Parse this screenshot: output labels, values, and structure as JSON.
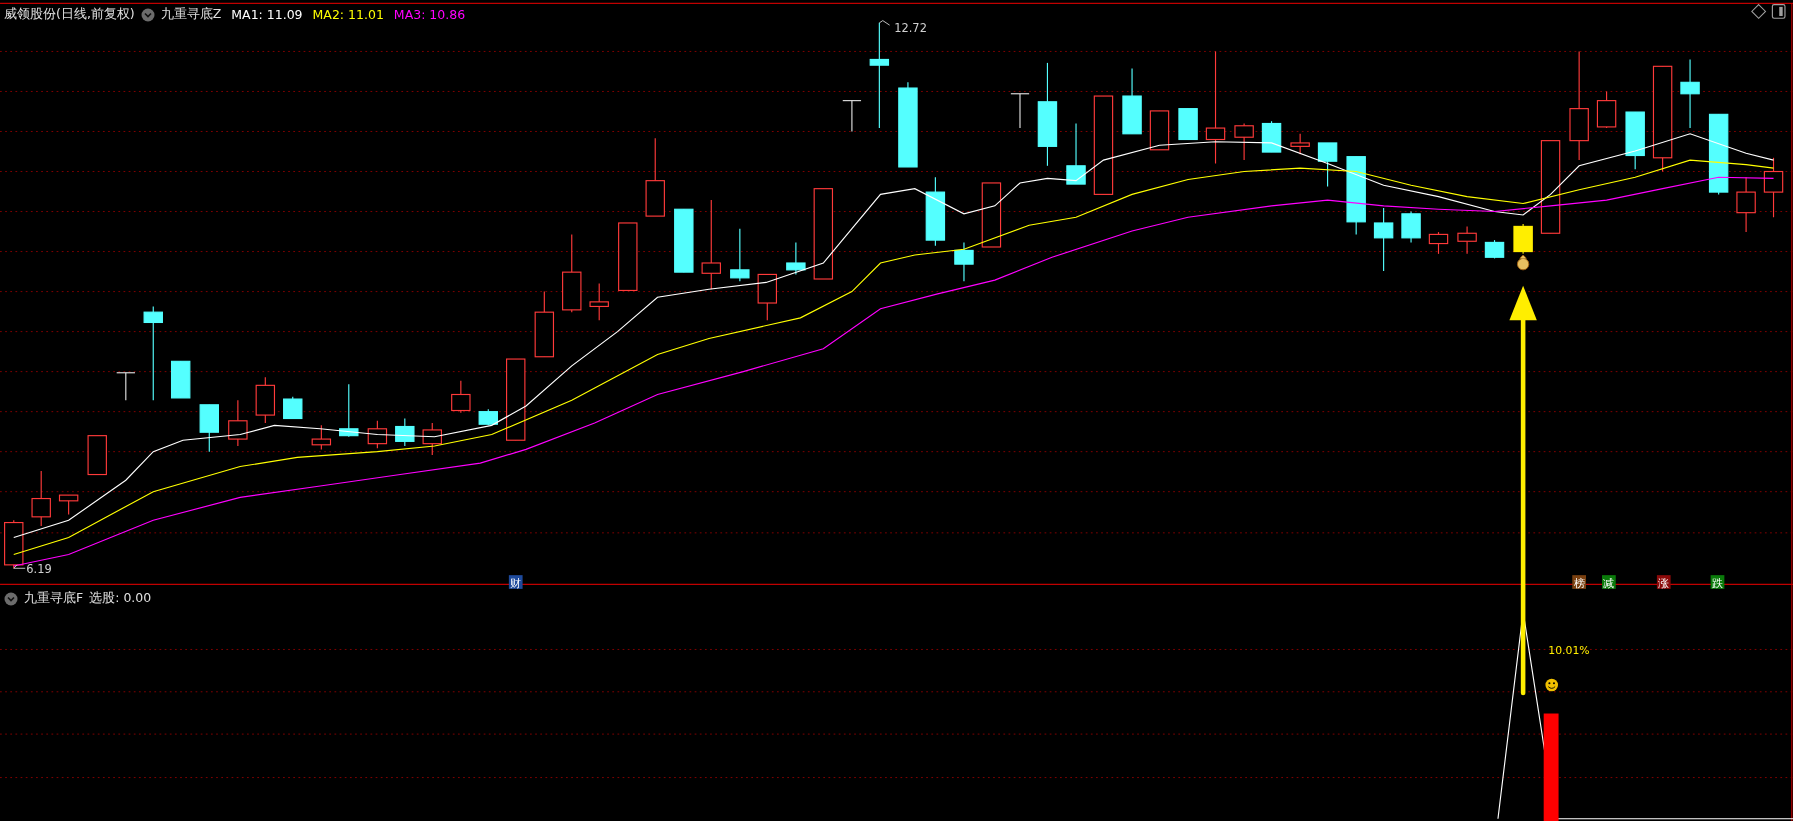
{
  "main_panel": {
    "stock_title": "威领股份(日线,前复权)",
    "indicator_name": "九重寻底Z",
    "ma_values": [
      {
        "label": "MA1: 11.09",
        "color": "#ffffff"
      },
      {
        "label": "MA2: 11.01",
        "color": "#ffff00"
      },
      {
        "label": "MA3: 10.86",
        "color": "#ff00ff"
      }
    ],
    "high_label": "12.72",
    "low_label": "6.19",
    "event_tags": [
      {
        "label": "财",
        "color": "#1e4a9c"
      },
      {
        "label": "榜",
        "color": "#7a4010"
      },
      {
        "label": "减",
        "color": "#0a7a0a"
      },
      {
        "label": "涨",
        "color": "#8c0a0a"
      },
      {
        "label": "跌",
        "color": "#0a7a0a"
      }
    ]
  },
  "sub_panel": {
    "indicator_name": "九重寻底F",
    "value_label": "选股: 0.00",
    "gain_label": "10.01%"
  }
}
